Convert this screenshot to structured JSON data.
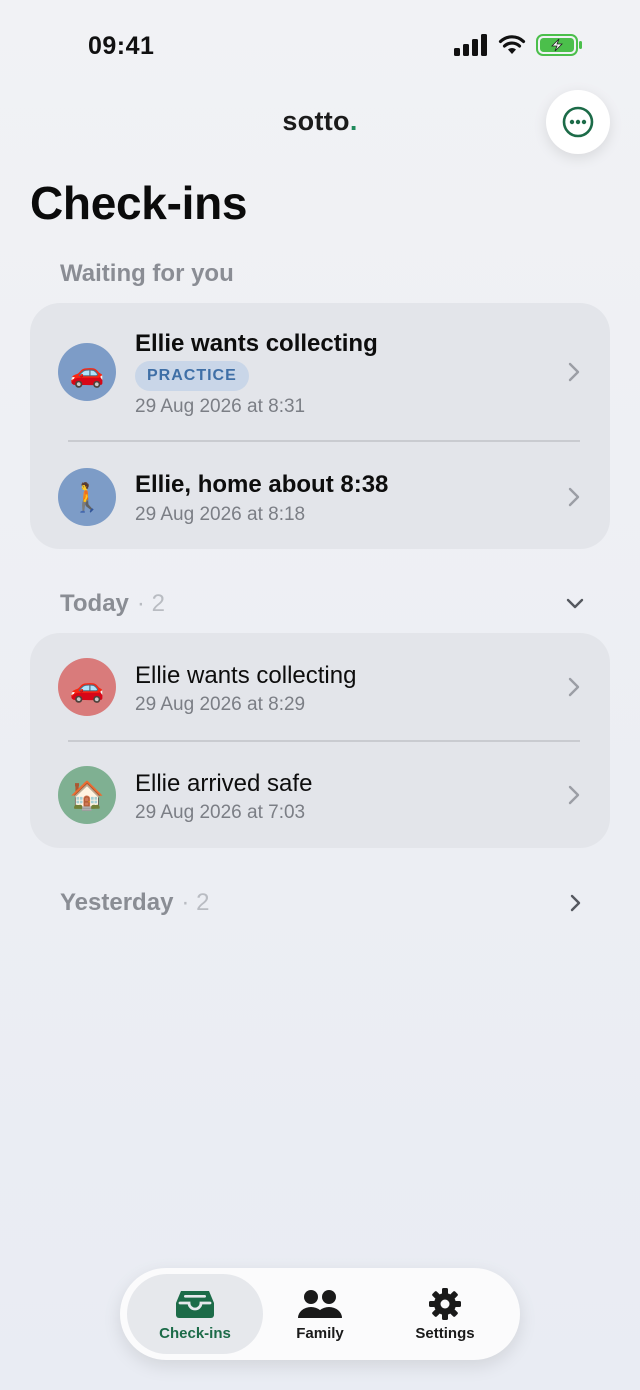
{
  "status_bar": {
    "time": "09:41"
  },
  "brand": {
    "name": "sotto",
    "dot": "."
  },
  "page": {
    "title": "Check-ins"
  },
  "waiting": {
    "header": "Waiting for you",
    "items": [
      {
        "emoji": "🚗",
        "title": "Ellie wants collecting",
        "tag": "PRACTICE",
        "time": "29 Aug 2026 at 8:31",
        "avatar_color": "#7d9cc7"
      },
      {
        "emoji": "🚶",
        "title": "Ellie, home about 8:38",
        "time": "29 Aug 2026 at 8:18",
        "avatar_color": "#7d9cc7"
      }
    ]
  },
  "today": {
    "header": "Today",
    "count": "· 2",
    "items": [
      {
        "emoji": "🚗",
        "title": "Ellie wants collecting",
        "time": "29 Aug 2026 at 8:29",
        "avatar_color": "#d97b7b"
      },
      {
        "emoji": "🏠",
        "title": "Ellie arrived safe",
        "time": "29 Aug 2026 at 7:03",
        "avatar_color": "#7fb092"
      }
    ]
  },
  "yesterday": {
    "header": "Yesterday",
    "count": "· 2"
  },
  "tabbar": {
    "tabs": [
      {
        "label": "Check-ins",
        "icon": "inbox-icon",
        "active": true
      },
      {
        "label": "Family",
        "icon": "people-icon",
        "active": false
      },
      {
        "label": "Settings",
        "icon": "gear-icon",
        "active": false
      }
    ]
  },
  "colors": {
    "accent": "#1c6b48",
    "brand_dot": "#1f8a5c",
    "card_bg": "#e3e5ea",
    "tag_bg": "#c9d6e8",
    "tag_text": "#3f6fa6"
  }
}
